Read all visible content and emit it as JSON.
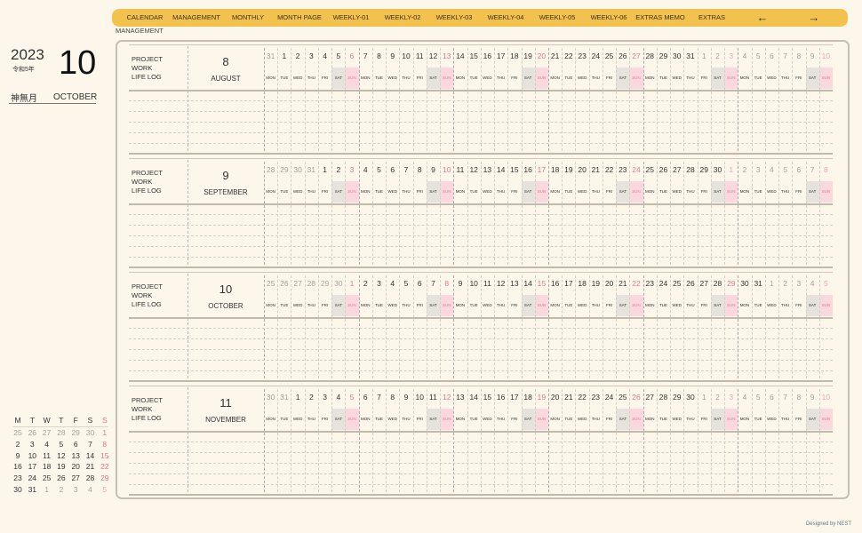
{
  "nav": {
    "items": [
      "CALENDAR",
      "MANAGEMENT",
      "MONTHLY",
      "MONTH PAGE",
      "WEEKLY-01",
      "WEEKLY-02",
      "WEEKLY-03",
      "WEEKLY-04",
      "WEEKLY-05",
      "WEEKLY-06",
      "EXTRAS MEMO",
      "EXTRAS"
    ],
    "prev": "←",
    "next": "→"
  },
  "breadcrumb": "MANAGEMENT",
  "side": {
    "year": "2023",
    "era": "令和5年",
    "month_number": "10",
    "month_kanji": "神無月",
    "month_name": "OCTOBER"
  },
  "mini_calendar": {
    "headers": [
      "M",
      "T",
      "W",
      "T",
      "F",
      "S",
      "S"
    ],
    "days": [
      25,
      26,
      27,
      28,
      29,
      30,
      1,
      2,
      3,
      4,
      5,
      6,
      7,
      8,
      9,
      10,
      11,
      12,
      13,
      14,
      15,
      16,
      17,
      18,
      19,
      20,
      21,
      22,
      23,
      24,
      25,
      26,
      27,
      28,
      29,
      30,
      31,
      1,
      2,
      3,
      4,
      5
    ],
    "in_month_start": 6,
    "in_month_count": 31
  },
  "weekdays": [
    "MON",
    "TUE",
    "WED",
    "THU",
    "FRI",
    "SAT",
    "SUN"
  ],
  "row_labels": [
    "PROJECT",
    "WORK",
    "LIFE LOG"
  ],
  "blocks": [
    {
      "month_number": "8",
      "month_name": "AUGUST",
      "days": [
        31,
        1,
        2,
        3,
        4,
        5,
        6,
        7,
        8,
        9,
        10,
        11,
        12,
        13,
        14,
        15,
        16,
        17,
        18,
        19,
        20,
        21,
        22,
        23,
        24,
        25,
        26,
        27,
        28,
        29,
        30,
        31,
        1,
        2,
        3,
        4,
        5,
        6,
        7,
        8,
        9,
        10
      ],
      "in_month_start": 1,
      "in_month_count": 31
    },
    {
      "month_number": "9",
      "month_name": "SEPTEMBER",
      "days": [
        28,
        29,
        30,
        31,
        1,
        2,
        3,
        4,
        5,
        6,
        7,
        8,
        9,
        10,
        11,
        12,
        13,
        14,
        15,
        16,
        17,
        18,
        19,
        20,
        21,
        22,
        23,
        24,
        25,
        26,
        27,
        28,
        29,
        30,
        1,
        2,
        3,
        4,
        5,
        6,
        7,
        8
      ],
      "in_month_start": 4,
      "in_month_count": 30
    },
    {
      "month_number": "10",
      "month_name": "OCTOBER",
      "days": [
        25,
        26,
        27,
        28,
        29,
        30,
        1,
        2,
        3,
        4,
        5,
        6,
        7,
        8,
        9,
        10,
        11,
        12,
        13,
        14,
        15,
        16,
        17,
        18,
        19,
        20,
        21,
        22,
        23,
        24,
        25,
        26,
        27,
        28,
        29,
        30,
        31,
        1,
        2,
        3,
        4,
        5
      ],
      "in_month_start": 6,
      "in_month_count": 31
    },
    {
      "month_number": "11",
      "month_name": "NOVEMBER",
      "days": [
        30,
        31,
        1,
        2,
        3,
        4,
        5,
        6,
        7,
        8,
        9,
        10,
        11,
        12,
        13,
        14,
        15,
        16,
        17,
        18,
        19,
        20,
        21,
        22,
        23,
        24,
        25,
        26,
        27,
        28,
        29,
        30,
        1,
        2,
        3,
        4,
        5,
        6,
        7,
        8,
        9,
        10
      ],
      "in_month_start": 2,
      "in_month_count": 30
    }
  ],
  "credit": "Designed by NEST",
  "colors": {
    "accent": "#f3c14e",
    "sunday": "#e07b8c",
    "sat_bg": "#e6e3dd",
    "sun_bg": "#f9d9de",
    "muted": "#a9a39a"
  }
}
